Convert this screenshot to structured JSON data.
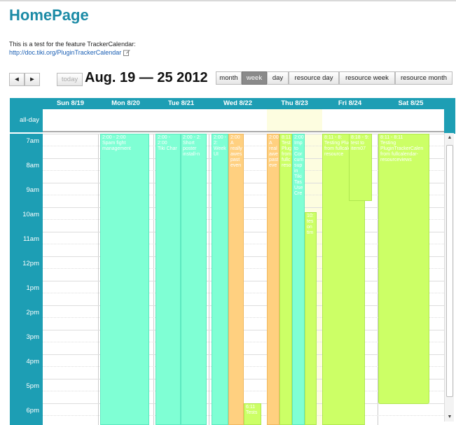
{
  "page": {
    "title": "HomePage",
    "description": "This is a test for the feature TrackerCalendar:",
    "link": "http://doc.tiki.org/PluginTrackerCalendar"
  },
  "toolbar": {
    "prev": "◄",
    "next": "►",
    "today": "today",
    "range_title": "Aug. 19 — 25 2012",
    "views": [
      "month",
      "week",
      "day",
      "resource day",
      "resource week",
      "resource month"
    ],
    "active_view": "week"
  },
  "calendar": {
    "days": [
      "Sun 8/19",
      "Mon 8/20",
      "Tue 8/21",
      "Wed 8/22",
      "Thu 8/23",
      "Fri 8/24",
      "Sat 8/25"
    ],
    "all_day_label": "all-day",
    "hours": [
      "7am",
      "8am",
      "9am",
      "10am",
      "11am",
      "12pm",
      "1pm",
      "2pm",
      "3pm",
      "4pm",
      "5pm",
      "6pm"
    ],
    "events": [
      {
        "day": 1,
        "start": "2:00 - 2:00",
        "text": "Spam fight management",
        "color": "#7fffd4"
      },
      {
        "day": 2,
        "start": "2:00 - 2:00",
        "text": "Tiki Char",
        "color": "#7fffd4"
      },
      {
        "day": 2,
        "start": "2:00 - 2:",
        "text": "Short poster install-n",
        "color": "#7fffd4"
      },
      {
        "day": 3,
        "start": "2:00 - 2:",
        "text": "Week UI",
        "color": "#7fffd4"
      },
      {
        "day": 3,
        "start": "2:00",
        "text": "A really awes past even",
        "color": "#ffd080"
      },
      {
        "day": 3,
        "start": "6:11",
        "text": "Tests",
        "color": "#ccff66"
      },
      {
        "day": 4,
        "start": "2:00",
        "text": "A real awe past eve",
        "color": "#ffd080"
      },
      {
        "day": 4,
        "start": "8:11",
        "text": "Test Plug from fullc reso",
        "color": "#ccff66"
      },
      {
        "day": 4,
        "start": "2:00",
        "text": "Imp to Cor cum sup in Tiki Tas Use Cre",
        "color": "#7fffd4"
      },
      {
        "day": 4,
        "start": "10:",
        "text": "tes on tim",
        "color": "#ccff66"
      },
      {
        "day": 5,
        "start": "8:11 - 8:",
        "text": "Testing PluginTr from fullcalen resource",
        "color": "#ccff66"
      },
      {
        "day": 5,
        "start": "8:18 - 9:",
        "text": "test to item07",
        "color": "#ccff66"
      },
      {
        "day": 6,
        "start": "8:11 - 8:11",
        "text": "Testing PluginTrackerCalen from fullcalendar-resourceviews",
        "color": "#ccff66"
      }
    ]
  }
}
